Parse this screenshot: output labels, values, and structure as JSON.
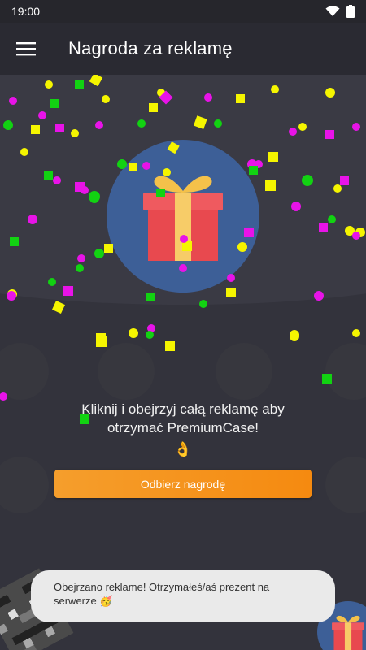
{
  "status_bar": {
    "time": "19:00"
  },
  "app_bar": {
    "title": "Nagroda za reklamę"
  },
  "main": {
    "message_line1": "Kliknij i obejrzyj całą reklamę aby",
    "message_line2": "otrzymać PremiumCase!",
    "message_emoji": "👌",
    "claim_button_label": "Odbierz nagrodę"
  },
  "toast": {
    "text": "Obejrzano reklame! Otrzymałeś/aś prezent na serwerze 🥳"
  },
  "colors": {
    "app_bar": "#2a2a32",
    "background": "#33333c",
    "gift_circle": "#3d5f97",
    "button_orange": "#f5921e",
    "confetti_yellow": "#f5f500",
    "confetti_magenta": "#e813e8",
    "confetti_green": "#12d212"
  },
  "icons": [
    "hamburger-menu-icon",
    "wifi-icon",
    "battery-icon",
    "gift-icon",
    "ok-hand-emoji"
  ]
}
